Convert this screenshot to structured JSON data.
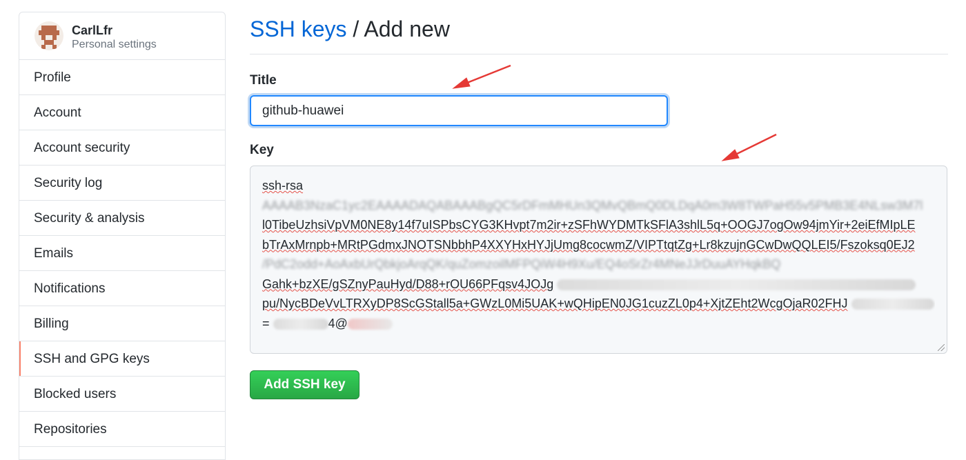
{
  "user": {
    "name": "CarlLfr",
    "subtitle": "Personal settings"
  },
  "sidebar": {
    "items": [
      {
        "label": "Profile"
      },
      {
        "label": "Account"
      },
      {
        "label": "Account security"
      },
      {
        "label": "Security log"
      },
      {
        "label": "Security & analysis"
      },
      {
        "label": "Emails"
      },
      {
        "label": "Notifications"
      },
      {
        "label": "Billing"
      },
      {
        "label": "SSH and GPG keys",
        "selected": true
      },
      {
        "label": "Blocked users"
      },
      {
        "label": "Repositories"
      }
    ]
  },
  "page": {
    "breadcrumb_link": "SSH keys",
    "breadcrumb_separator": " / ",
    "breadcrumb_current": "Add new"
  },
  "form": {
    "title_label": "Title",
    "title_value": "github-huawei",
    "key_label": "Key",
    "key_lines": [
      "ssh-rsa",
      "AAAAB3NzaC1yc2EAAAADAQABAAABgQC5rDFmMHUn3QMvQBmQ0DLDqA0m3W8TWPaH55v5PMB3E4NLsw3M7l",
      "l0TibeUzhsiVpVM0NE8y14f7uISPbsCYG3KHvpt7m2ir+zSFhWYDMTkSFlA3shlL5q+OOGJ7ogOw94jmYir+2eiEfMIpLE",
      "bTrAxMrnpb+MRtPGdmxJNOTSNbbhP4XXYHxHYJjUmg8cocwmZ/VIPTtqtZg+Lr8kzujnGCwDwQQLEI5/Fszoksq0EJ2",
      "/PdC2odd+AoAxbUrQbkjoArqQK/quZomzoilMFPQiW4H9Xu/EQ4oSrZr4MNeJJrDuuAYHqkBQ",
      "Gahk+bzXE/gSZnyPauHyd/D88+rOU66PFqsv4JOJg",
      "pu/NycBDeVvLTRXyDP8ScGStall5a+GWzL0Mi5UAK+wQHipEN0JG1cuzZL0p4+XjtZEht2WcgOjaR02FHJ",
      "= ",
      "4@"
    ],
    "submit_label": "Add SSH key"
  },
  "colors": {
    "link_blue": "#0366d6",
    "focus_blue": "#2188ff",
    "button_green": "#28a745",
    "selected_accent": "#f9826c",
    "annotation_red": "#e53935"
  }
}
